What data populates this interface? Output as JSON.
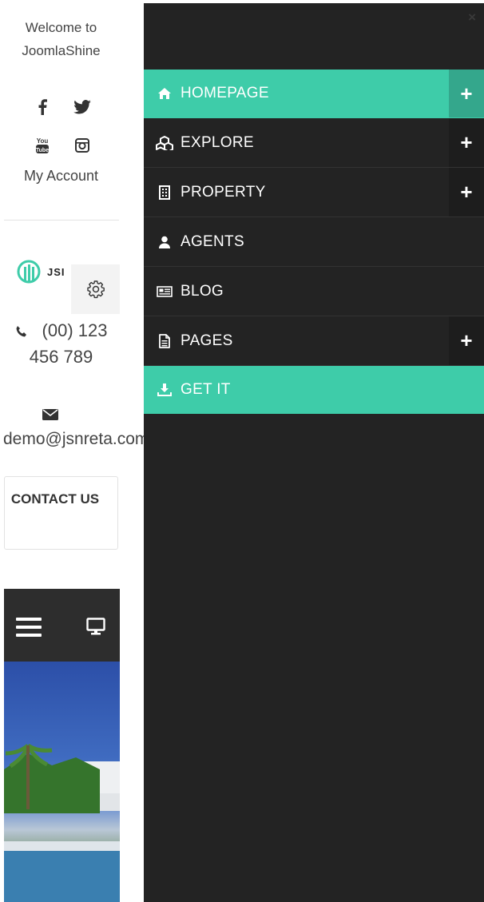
{
  "left": {
    "welcome": "Welcome to JoomlaShine",
    "account": "My Account",
    "logo_text": "JSI",
    "phone": "(00) 123 456 789",
    "email": "demo@jsnreta.com",
    "contact": "CONTACT US",
    "social_icons": [
      "facebook-icon",
      "twitter-icon",
      "youtube-icon",
      "instagram-icon"
    ]
  },
  "offcanvas": {
    "close": "×",
    "plus": "+",
    "items": [
      {
        "label": "HOMEPAGE",
        "icon": "home-icon",
        "active": true
      },
      {
        "label": "EXPLORE",
        "icon": "cubes-icon"
      },
      {
        "label": "PROPERTY",
        "icon": "building-icon"
      },
      {
        "label": "AGENTS",
        "icon": "user-icon"
      },
      {
        "label": "BLOG",
        "icon": "newspaper-icon"
      },
      {
        "label": "PAGES",
        "icon": "file-icon"
      },
      {
        "label": "GET IT",
        "icon": "download-icon"
      }
    ]
  },
  "colors": {
    "accent": "#3ecca9",
    "menu_bg": "#232323"
  }
}
